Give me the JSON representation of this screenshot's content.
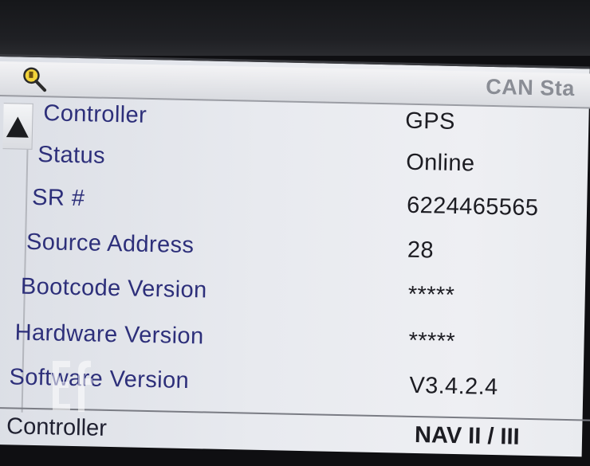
{
  "header": {
    "title": "CAN Sta",
    "search_icon": "magnifier-key-icon"
  },
  "rows": [
    {
      "label": "Controller",
      "value": "GPS"
    },
    {
      "label": "Status",
      "value": "Online"
    },
    {
      "label": "SR #",
      "value": "6224465565"
    },
    {
      "label": "Source Address",
      "value": "28"
    },
    {
      "label": "Bootcode Version",
      "value": "*****"
    },
    {
      "label": "Hardware Version",
      "value": "*****"
    },
    {
      "label": "Software Version",
      "value": "V3.4.2.4"
    }
  ],
  "next_section": {
    "label": "Controller",
    "value": "NAV II / III"
  },
  "colors": {
    "label_text": "#2d2f7a",
    "value_text": "#1c1c22"
  }
}
